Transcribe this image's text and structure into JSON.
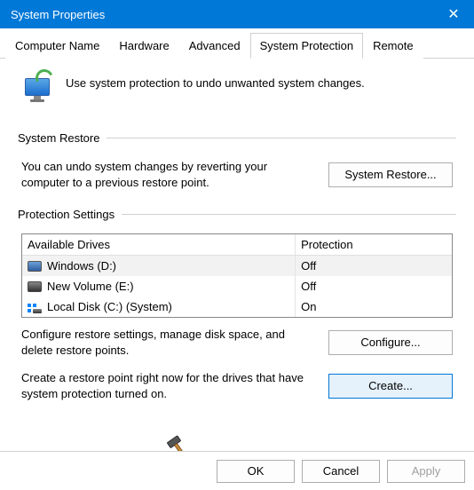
{
  "window": {
    "title": "System Properties",
    "close_glyph": "✕"
  },
  "tabs": [
    {
      "label": "Computer Name"
    },
    {
      "label": "Hardware"
    },
    {
      "label": "Advanced"
    },
    {
      "label": "System Protection",
      "active": true
    },
    {
      "label": "Remote"
    }
  ],
  "intro": "Use system protection to undo unwanted system changes.",
  "restore_group": {
    "title": "System Restore",
    "desc": "You can undo system changes by reverting your computer to a previous restore point.",
    "button": "System Restore..."
  },
  "protection_group": {
    "title": "Protection Settings",
    "col_drive": "Available Drives",
    "col_prot": "Protection",
    "drives": [
      {
        "icon": "hdd",
        "name": "Windows (D:)",
        "protection": "Off",
        "selected": true
      },
      {
        "icon": "hdd2",
        "name": "New Volume (E:)",
        "protection": "Off"
      },
      {
        "icon": "dots",
        "name": "Local Disk (C:) (System)",
        "protection": "On"
      }
    ],
    "configure_desc": "Configure restore settings, manage disk space, and delete restore points.",
    "configure_btn": "Configure...",
    "create_desc": "Create a restore point right now for the drives that have system protection turned on.",
    "create_btn": "Create..."
  },
  "footer": {
    "ok": "OK",
    "cancel": "Cancel",
    "apply": "Apply"
  }
}
